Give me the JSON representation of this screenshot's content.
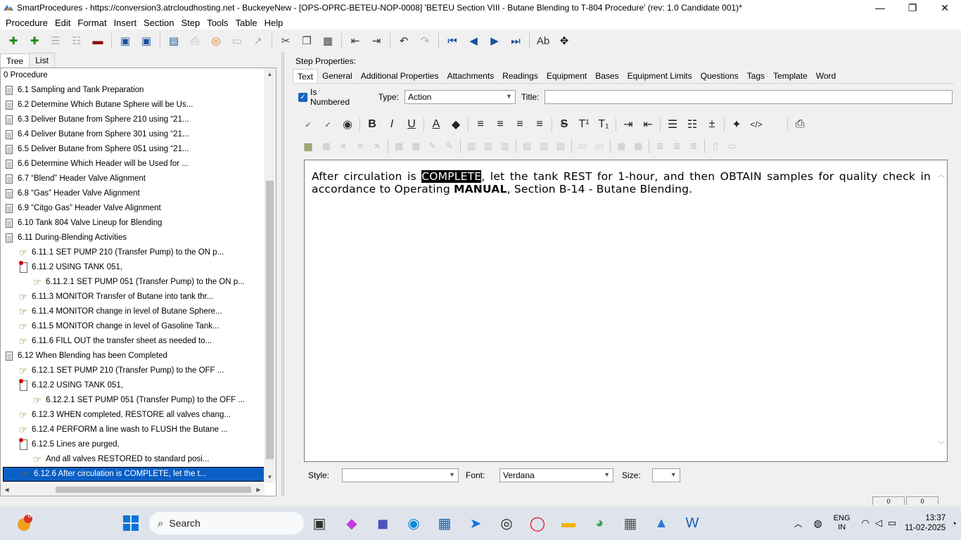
{
  "window": {
    "title": "SmartProcedures - https://conversion3.atrcloudhosting.net - BuckeyeNew - [OPS-OPRC-BETEU-NOP-0008] 'BETEU Section VIII - Butane Blending to T-804 Procedure' (rev: 1.0 Candidate 001)*",
    "minimize": "—",
    "restore": "❐",
    "close": "✕"
  },
  "menu": [
    "Procedure",
    "Edit",
    "Format",
    "Insert",
    "Section",
    "Step",
    "Tools",
    "Table",
    "Help"
  ],
  "left_tabs": [
    "Tree",
    "List"
  ],
  "tree": [
    {
      "label": "0 Procedure",
      "icon": "none",
      "indent": 0
    },
    {
      "label": "6.1 Sampling and Tank Preparation",
      "icon": "document-icon",
      "indent": 0
    },
    {
      "label": "6.2 Determine Which Butane Sphere will be Us...",
      "icon": "document-icon",
      "indent": 0
    },
    {
      "label": "6.3 Deliver Butane from Sphere 210 using “21...",
      "icon": "document-icon",
      "indent": 0
    },
    {
      "label": "6.4 Deliver Butane from Sphere 301 using “21...",
      "icon": "document-icon",
      "indent": 0
    },
    {
      "label": "6.5 Deliver Butane from Sphere 051 using “21...",
      "icon": "document-icon",
      "indent": 0
    },
    {
      "label": "6.6 Determine Which Header will be Used for ...",
      "icon": "document-icon",
      "indent": 0
    },
    {
      "label": "6.7 “Blend” Header Valve Alignment",
      "icon": "document-icon",
      "indent": 0
    },
    {
      "label": "6.8 “Gas” Header Valve Alignment",
      "icon": "document-icon",
      "indent": 0
    },
    {
      "label": "6.9 “Citgo Gas” Header Valve Alignment",
      "icon": "document-icon",
      "indent": 0
    },
    {
      "label": "6.10 Tank 804 Valve Lineup for Blending",
      "icon": "document-icon",
      "indent": 0
    },
    {
      "label": "6.11 During-Blending Activities",
      "icon": "document-icon",
      "indent": 0
    },
    {
      "label": "6.11.1 SET PUMP 210 (Transfer Pump) to the ON p...",
      "icon": "pointing-hand-icon",
      "indent": 1
    },
    {
      "label": "6.11.2 USING TANK 051,",
      "icon": "conditional-step-icon",
      "indent": 1
    },
    {
      "label": "6.11.2.1 SET PUMP 051 (Transfer Pump) to the ON p...",
      "icon": "pointing-hand-icon",
      "indent": 2
    },
    {
      "label": "6.11.3 MONITOR Transfer of Butane into tank thr...",
      "icon": "pointing-hand-icon",
      "indent": 1
    },
    {
      "label": "6.11.4 MONITOR change in level of Butane Sphere...",
      "icon": "pointing-hand-icon",
      "indent": 1
    },
    {
      "label": "6.11.5 MONITOR change in level of Gasoline Tank...",
      "icon": "pointing-hand-icon",
      "indent": 1
    },
    {
      "label": "6.11.6 FILL OUT the transfer sheet as needed to...",
      "icon": "pointing-hand-icon",
      "indent": 1
    },
    {
      "label": "6.12 When Blending has been Completed",
      "icon": "document-icon",
      "indent": 0
    },
    {
      "label": "6.12.1 SET PUMP 210 (Transfer Pump) to the OFF ...",
      "icon": "pointing-hand-icon",
      "indent": 1
    },
    {
      "label": "6.12.2 USING TANK 051,",
      "icon": "conditional-step-icon",
      "indent": 1
    },
    {
      "label": "6.12.2.1 SET PUMP 051 (Transfer Pump) to the OFF ...",
      "icon": "pointing-hand-icon",
      "indent": 2
    },
    {
      "label": "6.12.3 WHEN completed, RESTORE all valves chang...",
      "icon": "pointing-hand-icon",
      "indent": 1
    },
    {
      "label": "6.12.4 PERFORM a line wash to FLUSH the Butane ...",
      "icon": "pointing-hand-icon",
      "indent": 1
    },
    {
      "label": "6.12.5 Lines are purged,",
      "icon": "conditional-step-icon",
      "indent": 1
    },
    {
      "label": "And all valves RESTORED to standard posi...",
      "icon": "pointing-hand-icon",
      "indent": 2
    },
    {
      "label": "6.12.6 After circulation is COMPLETE, let the t...",
      "icon": "pointing-hand-icon",
      "indent": 1,
      "selected": true
    }
  ],
  "step_props": {
    "header": "Step Properties:",
    "tabs": [
      "Text",
      "General",
      "Additional Properties",
      "Attachments",
      "Readings",
      "Equipment",
      "Bases",
      "Equipment Limits",
      "Questions",
      "Tags",
      "Template",
      "Word"
    ],
    "is_numbered_label": "Is Numbered",
    "is_numbered_checked": true,
    "type_label": "Type:",
    "type_value": "Action",
    "title_label": "Title:",
    "title_value": ""
  },
  "editor": {
    "t1": "After circulation is ",
    "t2": "COMPLETE",
    "t3": ", let the tank REST for 1-hour, and then OBTAIN samples for quality check in accordance to Operating ",
    "t4": "MANUAL",
    "t5": ", Section B-14 - Butane Blending."
  },
  "bottom": {
    "style_label": "Style:",
    "style_value": "",
    "font_label": "Font:",
    "font_value": "Verdana",
    "size_label": "Size:",
    "size_value": ""
  },
  "status": [
    "0",
    "0"
  ],
  "taskbar": {
    "search_placeholder": "Search",
    "notif_badge": "8",
    "lang1": "ENG",
    "lang2": "IN",
    "time": "13:37",
    "date": "11-02-2025"
  }
}
